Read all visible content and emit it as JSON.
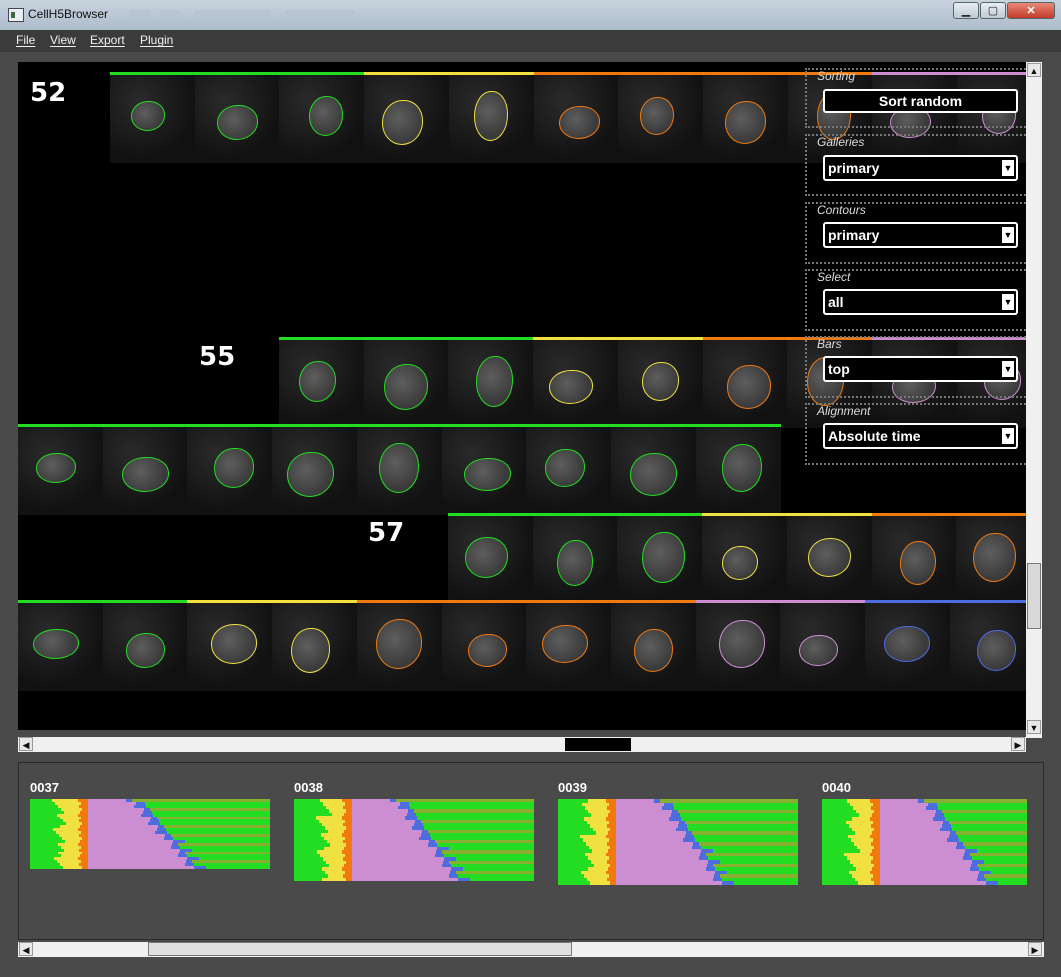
{
  "window": {
    "title": "CellH5Browser",
    "buttons": {
      "minimize": "▁",
      "maximize": "▢",
      "close": "✕"
    }
  },
  "menu": [
    "File",
    "View",
    "Export",
    "Plugin"
  ],
  "colors": {
    "green": "#22dd22",
    "yellow": "#f0e040",
    "orange": "#f07a10",
    "pink": "#cc8ed0",
    "blue": "#4c6ce0",
    "olive": "#88b030"
  },
  "gallery": {
    "tracks": [
      {
        "id": "52",
        "bar": [
          "green",
          "green",
          "green",
          "yellow",
          "yellow",
          "orange",
          "orange",
          "orange",
          "orange",
          "pink",
          "pink"
        ]
      },
      {
        "id": "55",
        "bar": [
          "green",
          "green",
          "green",
          "yellow",
          "yellow",
          "orange",
          "orange",
          "pink",
          "pink",
          "orange"
        ]
      },
      {
        "id": "",
        "bar": [
          "green",
          "green",
          "green",
          "green",
          "green",
          "green",
          "green",
          "green",
          "green"
        ]
      },
      {
        "id": "57",
        "bar": [
          "green",
          "green",
          "green",
          "yellow",
          "yellow",
          "orange",
          "orange"
        ]
      },
      {
        "id": "",
        "bar": [
          "green",
          "green",
          "yellow",
          "yellow",
          "orange",
          "orange",
          "orange",
          "orange",
          "pink",
          "pink",
          "blue",
          "blue"
        ]
      }
    ]
  },
  "controls": {
    "sorting": {
      "label": "Sorting",
      "button": "Sort random"
    },
    "galleries": {
      "label": "Galleries",
      "value": "primary"
    },
    "contours": {
      "label": "Contours",
      "value": "primary"
    },
    "select": {
      "label": "Select",
      "value": "all"
    },
    "bars": {
      "label": "Bars",
      "value": "top"
    },
    "alignment": {
      "label": "Alignment",
      "value": "Absolute time"
    }
  },
  "positions": [
    {
      "label": "0037"
    },
    {
      "label": "0038"
    },
    {
      "label": "0039"
    },
    {
      "label": "0040"
    }
  ]
}
